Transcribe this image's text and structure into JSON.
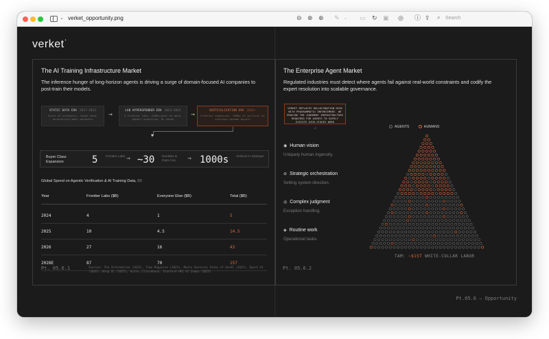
{
  "window": {
    "filename": "verket_opportunity.png",
    "search_placeholder": "Search",
    "toolbar_icons": [
      "zoom-out-icon",
      "zoom-in-icon",
      "zoom-fit-icon",
      "markup-pen-icon",
      "chevron-down-icon",
      "crop-icon",
      "rotate-icon",
      "adjust-icon",
      "annotate-icon",
      "info-icon",
      "share-icon",
      "search-icon"
    ]
  },
  "logo": "verket",
  "left": {
    "title": "The AI Training Infrastructure Market",
    "subtitle": "The inference hunger of long-horizon agents is driving a surge of domain-focused AI companies to post-train their models.",
    "eras": [
      {
        "title": "STATIC DATA ERA",
        "years": "2017–2023",
        "desc": "Scale AI economics, human-feed, annotation/label datasets"
      },
      {
        "title": "LAB HYPERSPENDER ERA",
        "years": "2023–2025",
        "desc": "5 frontier labs, $10M+/year on data, depart expertise, RL seeds"
      },
      {
        "title": "VERTICALIZATION ERA",
        "years": "2026→",
        "desc": "Frontier expansion, 1000s of vertical AI startups become buyers",
        "highlight": true
      }
    ],
    "expansion": {
      "label": "Buyer Class Expansion",
      "steps": [
        {
          "value": "5",
          "label": "Frontier Labs"
        },
        {
          "value": "~30",
          "label": "Neolabs & Data Cos"
        },
        {
          "value": "1000s",
          "label": "Vertical AI Startups"
        }
      ]
    },
    "table": {
      "caption": "Global Spend on Agentic Verification & AI Training Data,",
      "caption_unit": "$B",
      "headers": [
        "Year",
        "Frontier Labs ($B)",
        "Everyone Else ($B)",
        "Total ($B)"
      ],
      "rows": [
        [
          "2024",
          "4",
          "1",
          "5"
        ],
        [
          "2025",
          "10",
          "4.5",
          "14.5"
        ],
        [
          "2026",
          "27",
          "16",
          "43"
        ],
        [
          "2028E",
          "87",
          "70",
          "157"
        ]
      ]
    },
    "page_label": "Pt. 05.6.1",
    "sources": "Sources: The Information (2025), Time Magazine (2025), Menlo Ventures State of GenAI (2025), Epoch AI (2026), Wing VC (2025), Scale, Clairebase, Stanford HAI AI Index (2025)"
  },
  "right": {
    "title": "The Enterprise Agent Market",
    "subtitle": "Regulated industries must detect where agents fail against real-world constraints and codify the expert resolution into scalable governance.",
    "callout": "VERKET REPLACES HALLUCINATION RISK WITH PROGRAMMATIC ENFORCEMENT. WE PROVIDE THE JUDGMENT INFRASTRUCTURE REQUIRED FOR AGENTS TO SAFELY EXECUTE HIGH-STAKES WORK",
    "legend": {
      "agents": "AGENTS",
      "humans": "HUMANS"
    },
    "skills": [
      {
        "icon": "eye-icon",
        "glyph": "◉",
        "name": "Human vision",
        "desc": "Uniquely human ingenuity."
      },
      {
        "icon": "compass-icon",
        "glyph": "⊘",
        "name": "Strategic orchestration",
        "desc": "Setting system direction."
      },
      {
        "icon": "target-icon",
        "glyph": "◎",
        "name": "Complex judgment",
        "desc": "Exception handling."
      },
      {
        "icon": "layers-icon",
        "glyph": "◈",
        "name": "Routine work",
        "desc": "Operational tasks."
      }
    ],
    "tam_prefix": "TAM:",
    "tam_value": "~$1ST",
    "tam_suffix": "WHITE-COLLAR LABOR",
    "page_label": "Pt. 05.6.2"
  },
  "footer": "Pt.05.6 — Opportunity",
  "colors": {
    "accent": "#e06a3e",
    "background": "#1b1b1b",
    "agent_dot": "#6a6a6a"
  }
}
